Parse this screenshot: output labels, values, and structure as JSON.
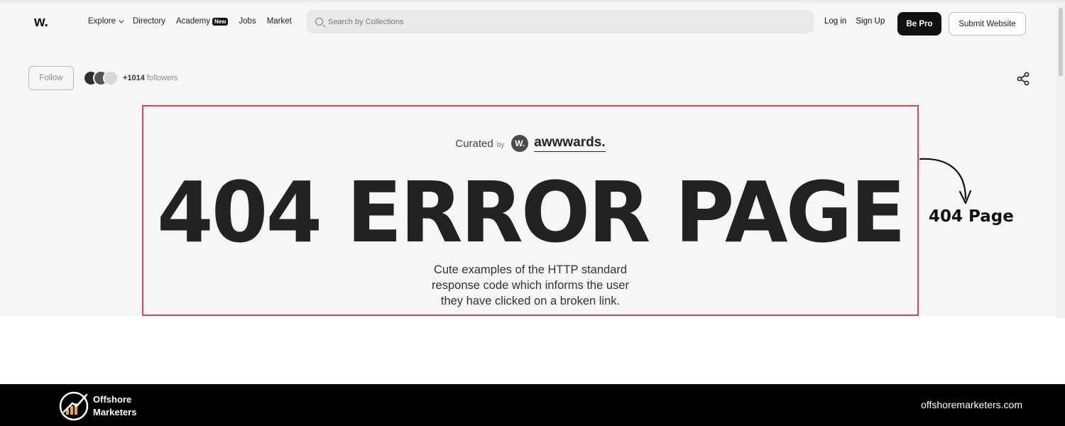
{
  "site": {
    "logo": "w.",
    "nav": {
      "explore": "Explore",
      "directory": "Directory",
      "academy": "Academy",
      "academy_badge": "New",
      "jobs": "Jobs",
      "market": "Market"
    },
    "search": {
      "placeholder": "Search by Collections"
    },
    "auth": {
      "login": "Log in",
      "signup": "Sign Up"
    },
    "buttons": {
      "be_pro": "Be Pro",
      "submit": "Submit Website"
    }
  },
  "collection": {
    "follow_label": "Follow",
    "followers_count": "+1014",
    "followers_label": "followers",
    "curated": "Curated",
    "curated_by": "by",
    "curator_logo": "W.",
    "curator_name": "awwwards.",
    "headline": "404 ERROR PAGE",
    "description_lines": [
      "Cute examples of the HTTP standard",
      "response code which informs the user",
      "they have clicked on a broken link."
    ]
  },
  "annotation": {
    "label": "404 Page",
    "highlight_color": "#e0454f"
  },
  "footer": {
    "brand_line1": "Offshore",
    "brand_line2": "Marketers",
    "url": "offshoremarketers.com"
  },
  "icons": [
    "search-icon",
    "chevron-down-icon",
    "share-icon",
    "arrow-icon",
    "offshore-marketers-logo-icon"
  ]
}
